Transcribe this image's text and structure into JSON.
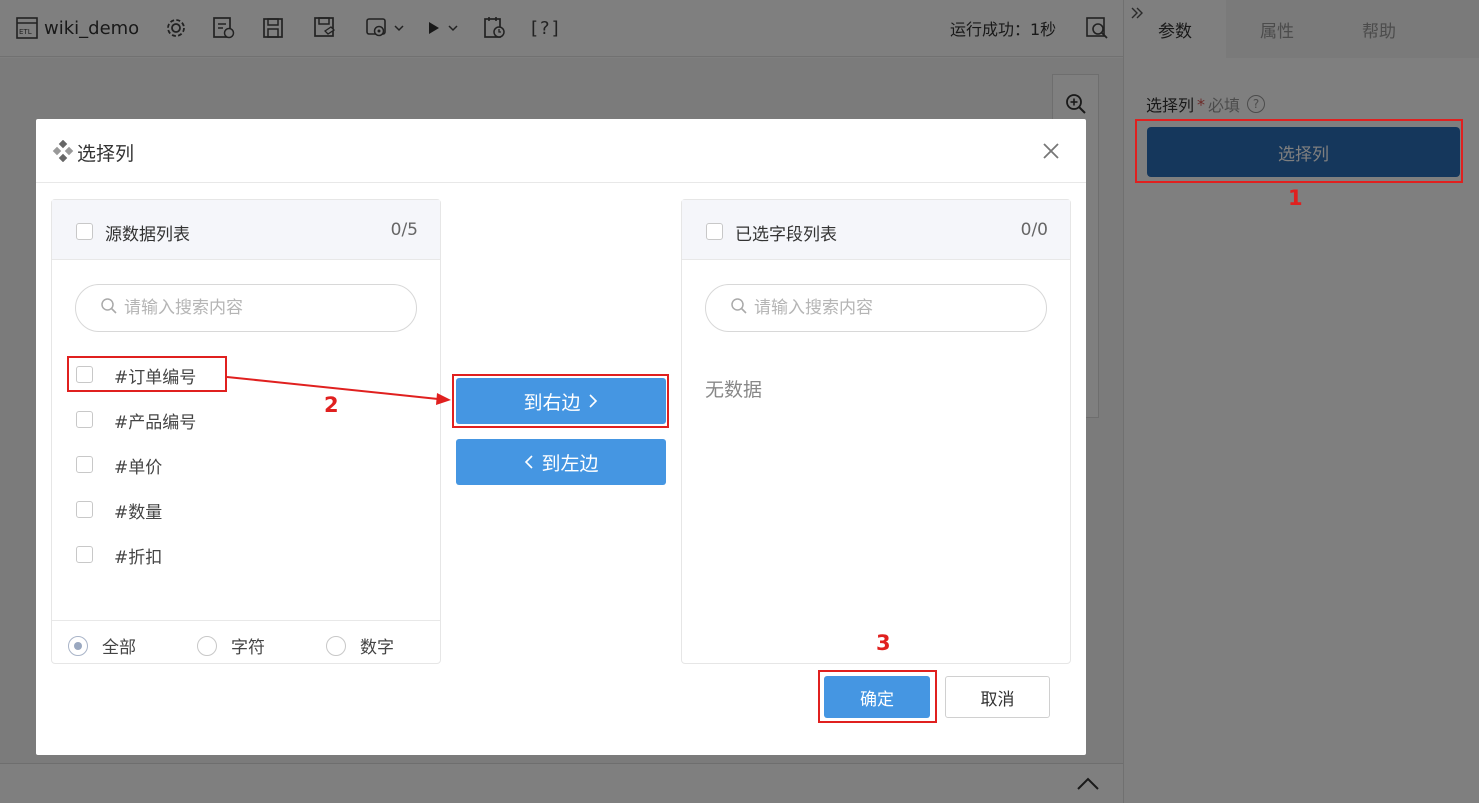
{
  "toolbar": {
    "app_title": "wiki_demo",
    "run_status": "运行成功：1秒",
    "help_bracket": "[?]"
  },
  "right_panel": {
    "tabs": [
      {
        "label": "参数",
        "active": true
      },
      {
        "label": "属性",
        "active": false
      },
      {
        "label": "帮助",
        "active": false
      }
    ],
    "field_label": "选择列",
    "required_mark": "*",
    "required_text": "必填",
    "help_icon": "?",
    "select_button_label": "选择列"
  },
  "dialog": {
    "title": "选择列",
    "left_panel": {
      "title": "源数据列表",
      "count": "0/5",
      "search_placeholder": "请输入搜索内容",
      "items": [
        {
          "label": "#订单编号"
        },
        {
          "label": "#产品编号"
        },
        {
          "label": "#单价"
        },
        {
          "label": "#数量"
        },
        {
          "label": "#折扣"
        }
      ],
      "filters": [
        {
          "label": "全部",
          "checked": true
        },
        {
          "label": "字符",
          "checked": false
        },
        {
          "label": "数字",
          "checked": false
        }
      ]
    },
    "right_panel": {
      "title": "已选字段列表",
      "count": "0/0",
      "search_placeholder": "请输入搜索内容",
      "empty_text": "无数据"
    },
    "to_right_label": "到右边",
    "to_left_label": "到左边",
    "confirm_label": "确定",
    "cancel_label": "取消"
  },
  "annotations": {
    "label_1": "1",
    "label_2": "2",
    "label_3": "3",
    "color": "#e0201f"
  },
  "colors": {
    "primary": "#4596e2",
    "select_button": "#2a6fb8"
  }
}
